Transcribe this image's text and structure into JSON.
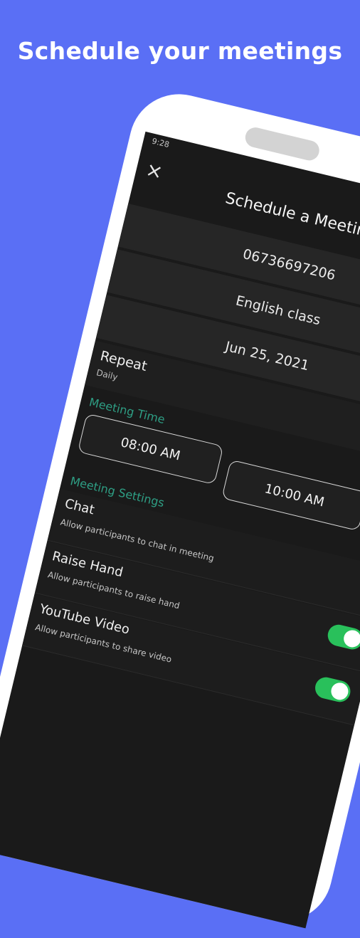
{
  "headline": "Schedule your meetings",
  "status": {
    "time": "9:28",
    "icons": "◉ ▾ ▮"
  },
  "header": {
    "title": "Schedule a Meeting"
  },
  "fields": {
    "meeting_id": "06736697206",
    "topic": "English class",
    "date": "Jun 25, 2021"
  },
  "repeat": {
    "label": "Repeat",
    "value": "Daily"
  },
  "meeting_time": {
    "section_label": "Meeting Time",
    "start": "08:00 AM",
    "end": "10:00 AM"
  },
  "settings": {
    "section_label": "Meeting Settings",
    "items": [
      {
        "label": "Chat",
        "sub": "Allow participants to chat in meeting"
      },
      {
        "label": "Raise Hand",
        "sub": "Allow participants to raise hand",
        "enabled": true
      },
      {
        "label": "YouTube Video",
        "sub": "Allow participants to share video",
        "enabled": true
      }
    ]
  },
  "colors": {
    "background": "#5a6ff5",
    "accent": "#2e9e84",
    "toggle_on": "#29c05b"
  }
}
